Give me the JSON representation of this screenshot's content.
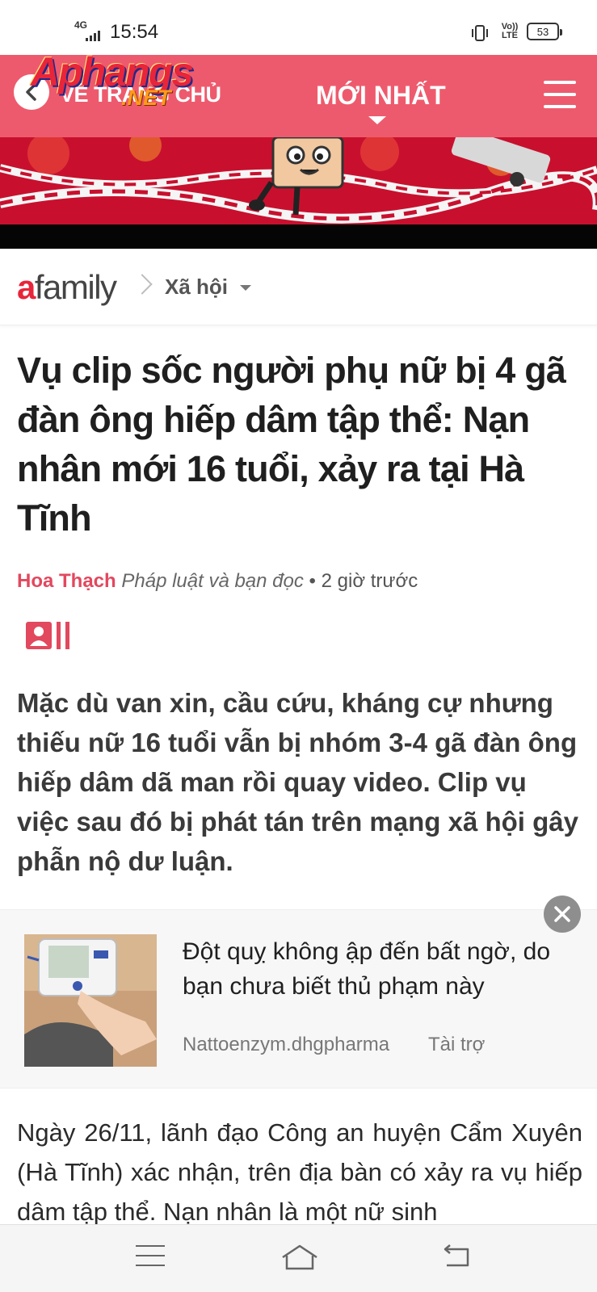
{
  "status_bar": {
    "network": "4G",
    "time": "15:54",
    "volte": "Vo)) LTE",
    "battery": "53"
  },
  "header": {
    "logo_text": "Aphangs",
    "logo_suffix": ".NET",
    "back_label": "VỀ TRANG CHỦ",
    "nav_title": "MỚI NHẤT",
    "accent_color": "#ee5a6d"
  },
  "breadcrumb": {
    "site_logo_a": "a",
    "site_logo_rest": "family",
    "category": "Xã hội"
  },
  "article": {
    "headline": "Vụ clip sốc người phụ nữ bị 4 gã đàn ông hiếp dâm tập thể: Nạn nhân mới 16 tuổi, xảy ra tại Hà Tĩnh",
    "author": "Hoa Thạch",
    "source": "Pháp luật và bạn đọc",
    "separator": "•",
    "time_ago": "2 giờ trước",
    "sapo": "Mặc dù van xin, cầu cứu, kháng cự nhưng thiếu nữ 16 tuổi vẫn bị nhóm 3-4 gã đàn ông hiếp dâm dã man rồi quay video. Clip vụ việc sau đó bị phát tán trên mạng xã hội gây phẫn nộ dư luận.",
    "body": "Ngày 26/11, lãnh đạo Công an huyện Cẩm Xuyên (Hà Tĩnh) xác nhận, trên địa bàn có xảy ra vụ hiếp dâm tập thể. Nạn nhân là một nữ sinh"
  },
  "ad": {
    "title": "Đột quỵ không ập đến bất ngờ, do bạn chưa biết thủ phạm này",
    "source": "Nattoenzym.dhgpharma",
    "tag": "Tài trợ"
  },
  "icons": [
    "back-icon",
    "menu-icon",
    "gallery-icon",
    "close-icon",
    "nav-menu-icon",
    "home-icon",
    "nav-back-icon"
  ]
}
